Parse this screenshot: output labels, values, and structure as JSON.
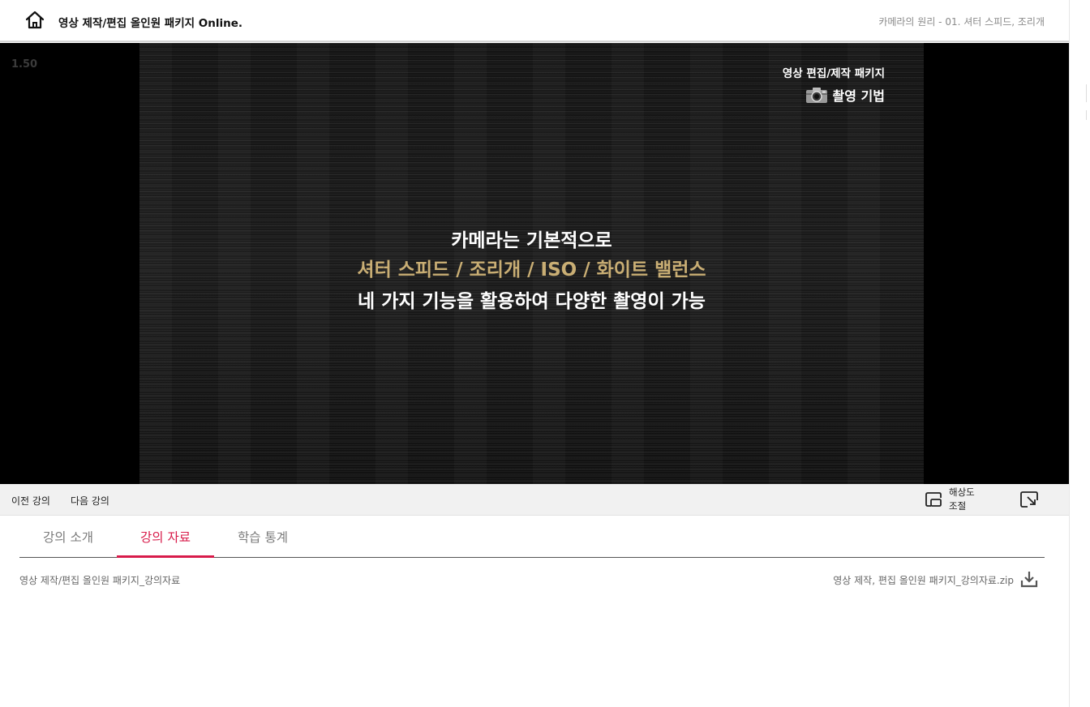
{
  "header": {
    "course_title": "영상 제작/편집 올인원 패키지 Online.",
    "lesson_crumb": "카메라의 원리 - 01. 셔터 스피드, 조리개"
  },
  "player": {
    "speed": "1.50",
    "brand": {
      "line1": "영상 편집/제작 패키지",
      "line2": "촬영 기법",
      "icon": "camera-icon"
    },
    "captions": {
      "line1": "카메라는 기본적으로",
      "line2": "셔터 스피드 / 조리개 / ISO / 화이트 밸런스",
      "line3": "네 가지 기능을 활용하여 다양한 촬영이 가능"
    },
    "caption_highlight_color": "#c9ae74"
  },
  "controls": {
    "prev_label": "이전 강의",
    "next_label": "다음 강의",
    "resolution_label_1": "해상도",
    "resolution_label_2": "조절"
  },
  "tabs": {
    "items": [
      {
        "label": "강의 소개",
        "active": false
      },
      {
        "label": "강의 자료",
        "active": true
      },
      {
        "label": "학습 통계",
        "active": false
      }
    ],
    "active_color": "#d81b4a"
  },
  "materials": {
    "title": "영상 제작/편집 올인원 패키지_강의자료",
    "file_name": "영상 제작, 편집 올인원 패키지_강의자료.zip"
  }
}
